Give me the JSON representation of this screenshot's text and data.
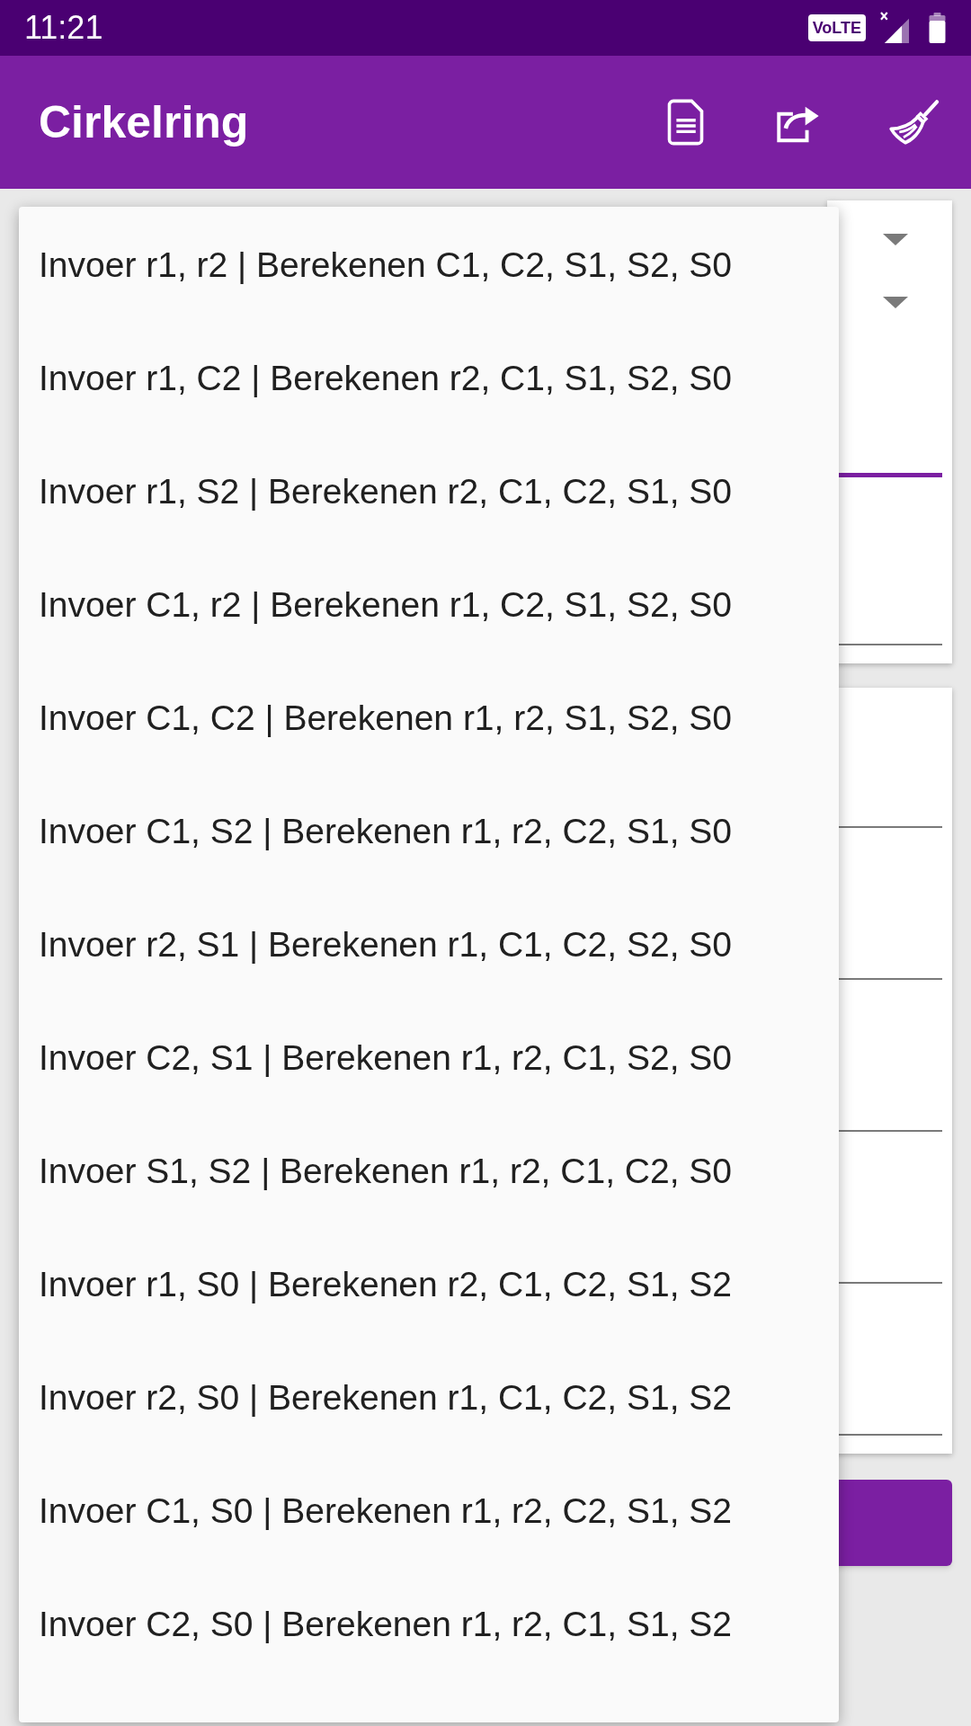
{
  "status_bar": {
    "time": "11:21",
    "network_badge": "VoLTE"
  },
  "app_bar": {
    "title": "Cirkelring"
  },
  "cards": [
    {
      "dropdowns": [
        {
          "expanded": true,
          "options": [
            "Invoer r1, r2 | Berekenen C1, C2, S1, S2, S0",
            "Invoer r1, C2 | Berekenen r2, C1, S1, S2, S0",
            "Invoer r1, S2 | Berekenen r2, C1, C2, S1, S0",
            "Invoer C1, r2 | Berekenen r1, C2, S1, S2, S0",
            "Invoer C1, C2 | Berekenen r1, r2, S1, S2, S0",
            "Invoer C1, S2 | Berekenen r1, r2, C2, S1, S0",
            "Invoer r2, S1 | Berekenen r1, C1, C2, S2, S0",
            "Invoer C2, S1 | Berekenen r1, r2, C1, S2, S0",
            "Invoer S1, S2 | Berekenen r1, r2, C1, C2, S0",
            "Invoer r1, S0 | Berekenen r2, C1, C2, S1, S2",
            "Invoer r2, S0 | Berekenen r1, C1, C2, S1, S2",
            "Invoer C1, S0 | Berekenen r1, r2, C2, S1, S2",
            "Invoer C2, S0 | Berekenen r1, r2, C1, S1, S2"
          ]
        },
        {
          "expanded": false
        }
      ],
      "fields": [
        {
          "focused": true
        },
        {
          "focused": false
        }
      ]
    },
    {
      "fields": [
        {
          "focused": false
        },
        {
          "focused": false
        },
        {
          "focused": false
        },
        {
          "focused": false
        },
        {
          "focused": false
        }
      ]
    }
  ]
}
